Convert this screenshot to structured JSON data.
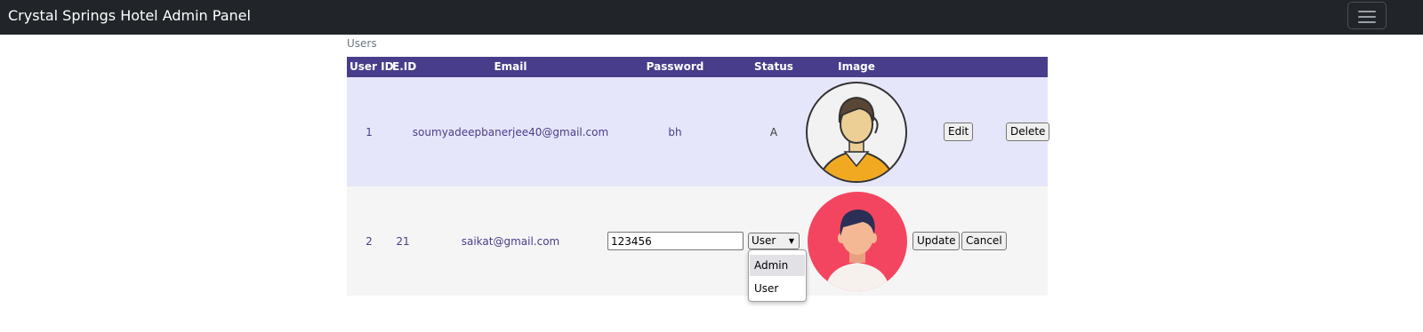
{
  "navbar": {
    "brand": "Crystal Springs Hotel Admin Panel",
    "menu_icon": "hamburger-icon"
  },
  "table": {
    "caption": "Users",
    "header_color": "#483d8b",
    "headers": {
      "user_id": "User ID",
      "eid": "E.ID",
      "email": "Email",
      "password": "Password",
      "status": "Status",
      "image": "Image"
    },
    "rows": [
      {
        "user_id": "1",
        "eid": "",
        "email": "soumyadeepbanerjee40@gmail.com",
        "password": "bh",
        "status": "A",
        "image": "male-avatar-icon",
        "edit_label": "Edit",
        "delete_label": "Delete",
        "background": "#e6e6fa"
      },
      {
        "user_id": "2",
        "eid": "21",
        "email": "saikat@gmail.com",
        "password_value": "123456",
        "status_selected": "User",
        "status_options": [
          "Admin",
          "User"
        ],
        "image": "male-avatar-icon",
        "update_label": "Update",
        "cancel_label": "Cancel",
        "background": "#f5f5f5"
      }
    ]
  }
}
